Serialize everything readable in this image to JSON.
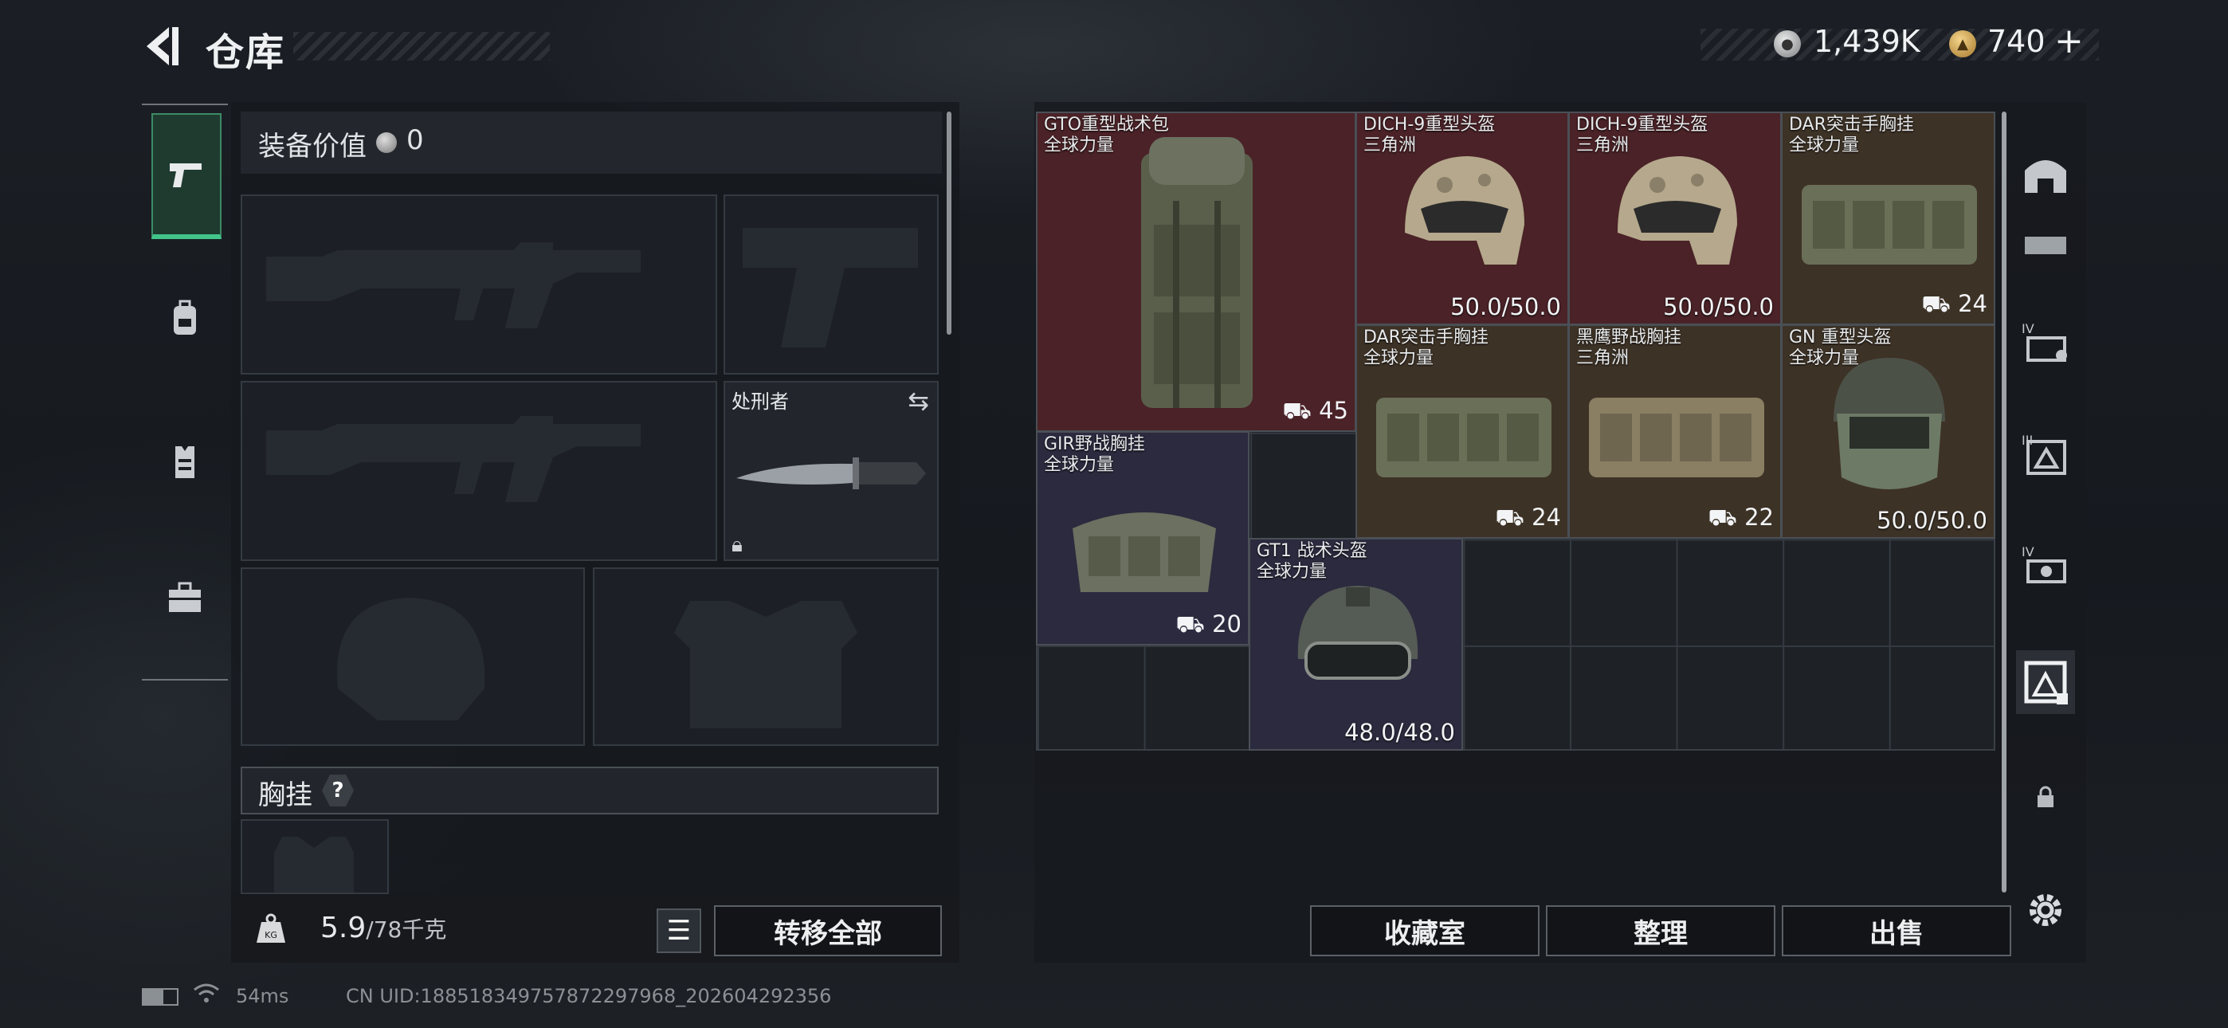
{
  "header": {
    "title": "仓库",
    "silver": "1,439K",
    "gold": "740",
    "gold_plus": "+"
  },
  "left": {
    "value_label": "装备价值",
    "value": "0",
    "melee_name": "处刑者",
    "chest_label": "胸挂",
    "chest_help": "?",
    "weight_current": "5.9",
    "weight_max": "/78千克",
    "transfer_all": "转移全部"
  },
  "items": [
    {
      "name": "GTO重型战术包",
      "sub": "全球力量",
      "value": "45",
      "rarity": "red"
    },
    {
      "name": "DICH-9重型头盔",
      "sub": "三角洲",
      "value": "50.0/50.0",
      "rarity": "red"
    },
    {
      "name": "DICH-9重型头盔",
      "sub": "三角洲",
      "value": "50.0/50.0",
      "rarity": "red"
    },
    {
      "name": "DAR突击手胸挂",
      "sub": "全球力量",
      "value": "24",
      "rarity": "brown"
    },
    {
      "name": "DAR突击手胸挂",
      "sub": "全球力量",
      "value": "24",
      "rarity": "brown"
    },
    {
      "name": "黑鹰野战胸挂",
      "sub": "三角洲",
      "value": "22",
      "rarity": "brown"
    },
    {
      "name": "GN 重型头盔",
      "sub": "全球力量",
      "value": "50.0/50.0",
      "rarity": "brown"
    },
    {
      "name": "GIR野战胸挂",
      "sub": "全球力量",
      "value": "20",
      "rarity": "purple"
    },
    {
      "name": "GT1 战术头盔",
      "sub": "全球力量",
      "value": "48.0/48.0",
      "rarity": "purple"
    }
  ],
  "buttons": {
    "collection": "收藏室",
    "sort": "整理",
    "sell": "出售"
  },
  "status": {
    "ping": "54ms",
    "uid": "CN UID:1885183497578722979​68_202604292356"
  }
}
